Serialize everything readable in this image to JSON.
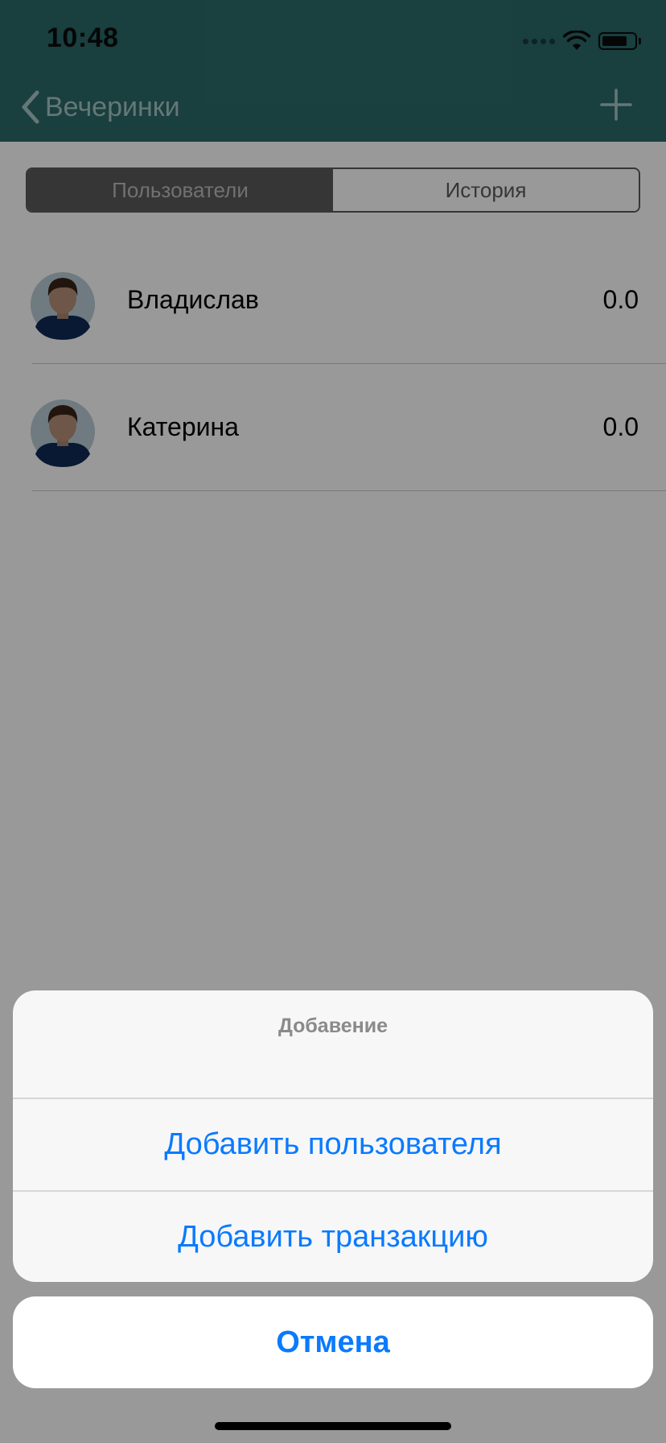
{
  "status_bar": {
    "time": "10:48"
  },
  "nav": {
    "back_label": "Вечеринки"
  },
  "segmented": {
    "users_label": "Пользователи",
    "history_label": "История"
  },
  "users": [
    {
      "name": "Владислав",
      "amount": "0.0"
    },
    {
      "name": "Катерина",
      "amount": "0.0"
    }
  ],
  "action_sheet": {
    "title": "Добавение",
    "add_user_label": "Добавить пользователя",
    "add_transaction_label": "Добавить транзакцию",
    "cancel_label": "Отмена"
  },
  "colors": {
    "nav_background": "#2b6a69",
    "accent": "#0a7aff",
    "segment_active": "#5a5a5a"
  },
  "icons": [
    "back-chevron-icon",
    "plus-icon",
    "wifi-icon",
    "battery-icon",
    "cellular-signal-icon",
    "user-avatar-icon"
  ]
}
